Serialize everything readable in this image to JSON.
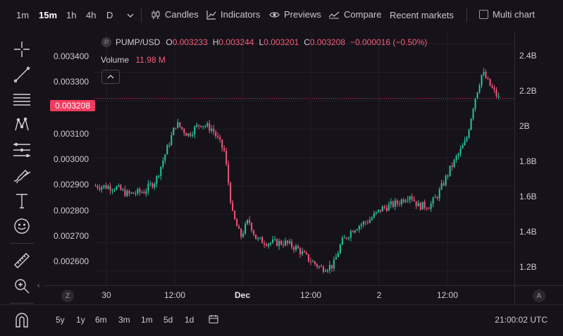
{
  "toolbar": {
    "timeframes": [
      "1m",
      "15m",
      "1h",
      "4h",
      "D"
    ],
    "active_timeframe": "15m",
    "candles": "Candles",
    "indicators": "Indicators",
    "previews": "Previews",
    "compare": "Compare",
    "recent_markets": "Recent markets",
    "multi_chart": "Multi chart"
  },
  "legend": {
    "symbol_icon": "P",
    "symbol": "PUMP/USD",
    "open_key": "O",
    "open": "0.003233",
    "high_key": "H",
    "high": "0.003244",
    "low_key": "L",
    "low": "0.003201",
    "close_key": "C",
    "close": "0.003208",
    "change": "−0.000016 (−0.50%)",
    "volume_label": "Volume",
    "volume_value": "11.98 M"
  },
  "price_axis": [
    "0.003400",
    "0.003300",
    "0.003100",
    "0.003000",
    "0.002900",
    "0.002800",
    "0.002700",
    "0.002600"
  ],
  "current_price_tag": "0.003208",
  "volume_axis": [
    "2.4B",
    "2.2B",
    "2B",
    "1.8B",
    "1.6B",
    "1.4B",
    "1.2B"
  ],
  "time_axis": {
    "labels": [
      "30",
      "12:00",
      "Dec",
      "12:00",
      "2",
      "12:00"
    ],
    "bold": [
      "Dec"
    ],
    "left_btn": "Z",
    "right_btn": "A"
  },
  "bottom": {
    "ranges": [
      "5y",
      "1y",
      "6m",
      "3m",
      "1m",
      "5d",
      "1d"
    ],
    "clock": "21:00:02 UTC"
  },
  "colors": {
    "up": "#26c6a0",
    "down": "#f2557a",
    "price_tag": "#f23b5f",
    "background": "#161219"
  },
  "chart_data": {
    "type": "candlestick",
    "symbol": "PUMP/USD",
    "interval": "15m",
    "ylim": [
      0.00255,
      0.003445
    ],
    "close_points": [
      [
        0,
        0.0029
      ],
      [
        0.05,
        0.002895
      ],
      [
        0.08,
        0.00287
      ],
      [
        0.12,
        0.00288
      ],
      [
        0.15,
        0.00292
      ],
      [
        0.17,
        0.003
      ],
      [
        0.2,
        0.00312
      ],
      [
        0.23,
        0.00308
      ],
      [
        0.26,
        0.00312
      ],
      [
        0.29,
        0.0031
      ],
      [
        0.32,
        0.00302
      ],
      [
        0.34,
        0.0028
      ],
      [
        0.36,
        0.00272
      ],
      [
        0.38,
        0.00278
      ],
      [
        0.4,
        0.00271
      ],
      [
        0.43,
        0.0027
      ],
      [
        0.47,
        0.0027
      ],
      [
        0.5,
        0.00268
      ],
      [
        0.53,
        0.00264
      ],
      [
        0.56,
        0.00261
      ],
      [
        0.59,
        0.00262
      ],
      [
        0.61,
        0.0027
      ],
      [
        0.64,
        0.00275
      ],
      [
        0.68,
        0.00278
      ],
      [
        0.71,
        0.00282
      ],
      [
        0.75,
        0.00284
      ],
      [
        0.78,
        0.00287
      ],
      [
        0.8,
        0.00283
      ],
      [
        0.83,
        0.00283
      ],
      [
        0.85,
        0.00287
      ],
      [
        0.88,
        0.00296
      ],
      [
        0.92,
        0.00306
      ],
      [
        0.94,
        0.0032
      ],
      [
        0.96,
        0.0033
      ],
      [
        0.98,
        0.00325
      ],
      [
        1.0,
        0.003208
      ]
    ]
  }
}
